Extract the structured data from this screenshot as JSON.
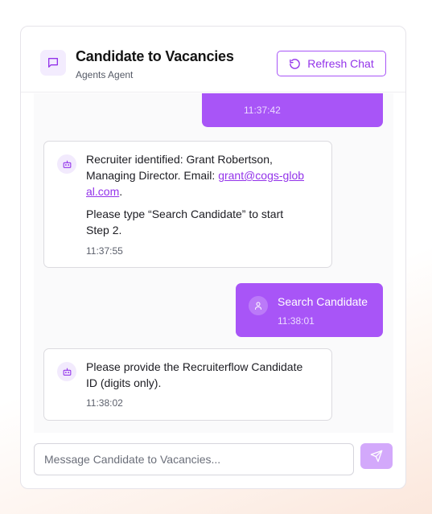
{
  "header": {
    "title": "Candidate to Vacancies",
    "subtitle": "Agents Agent",
    "icon": "chat-bubble-icon",
    "refresh_label": "Refresh Chat",
    "refresh_icon": "refresh-icon"
  },
  "messages": [
    {
      "role": "user",
      "text": "",
      "time": "11:37:42"
    },
    {
      "role": "agent",
      "line1_prefix": "Recruiter identified: Grant Robertson,",
      "line2_prefix": "Managing Director. Email: ",
      "email_part1": "grant@cogs-glob",
      "email_part2": "al.com",
      "line3_suffix": ".",
      "para2_line1": "Please type “Search Candidate” to start",
      "para2_line2": "Step 2.",
      "time": "11:37:55"
    },
    {
      "role": "user",
      "text": "Search Candidate",
      "time": "11:38:01"
    },
    {
      "role": "agent",
      "line1": "Please provide the Recruiterflow Candidate",
      "line2": "ID (digits only).",
      "time": "11:38:02"
    }
  ],
  "composer": {
    "placeholder": "Message Candidate to Vacancies...",
    "send_icon": "send-icon"
  },
  "colors": {
    "accent": "#a855f7",
    "accent_text": "#9333ea",
    "send_disabled": "#d3a9fb"
  }
}
